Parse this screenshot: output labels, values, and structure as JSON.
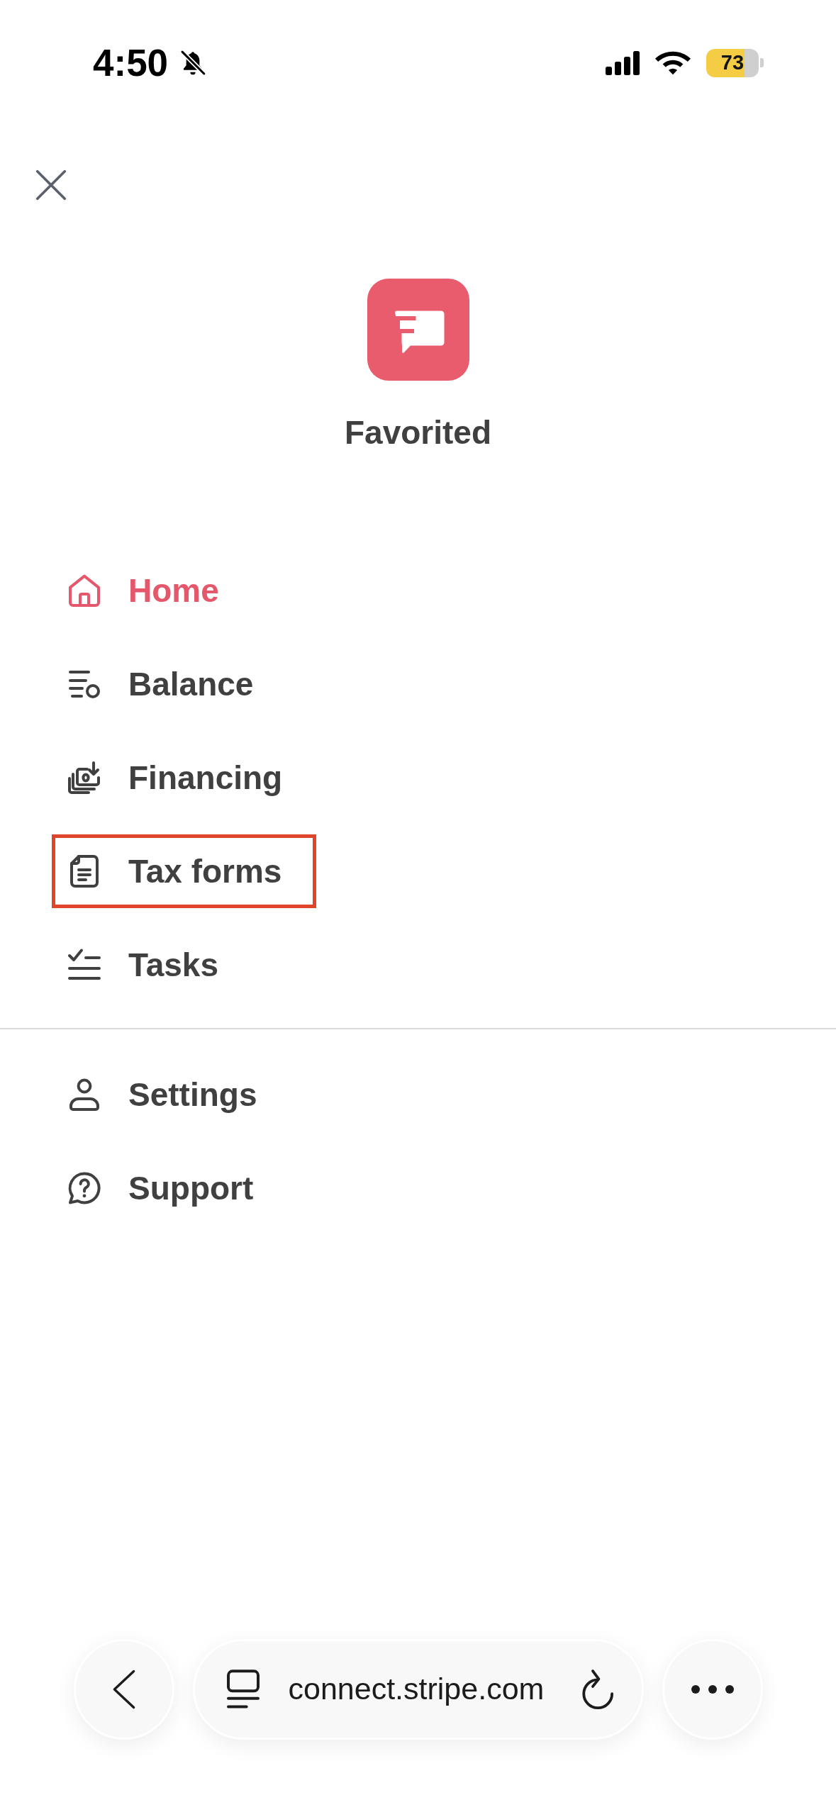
{
  "status_bar": {
    "time": "4:50",
    "silent": true,
    "battery": "73"
  },
  "app": {
    "name": "Favorited"
  },
  "nav": {
    "sections": [
      {
        "items": [
          {
            "kind": "home",
            "label": "Home",
            "selected": true,
            "highlighted": false
          },
          {
            "kind": "balance",
            "label": "Balance",
            "selected": false,
            "highlighted": false
          },
          {
            "kind": "financing",
            "label": "Financing",
            "selected": false,
            "highlighted": false
          },
          {
            "kind": "forms",
            "label": "Tax forms",
            "selected": false,
            "highlighted": true
          },
          {
            "kind": "tasks",
            "label": "Tasks",
            "selected": false,
            "highlighted": false
          }
        ]
      },
      {
        "items": [
          {
            "kind": "account",
            "label": "Settings",
            "selected": false,
            "highlighted": false
          },
          {
            "kind": "support",
            "label": "Support",
            "selected": false,
            "highlighted": false
          }
        ]
      }
    ]
  },
  "browser_bar": {
    "url": "connect.stripe.com"
  }
}
